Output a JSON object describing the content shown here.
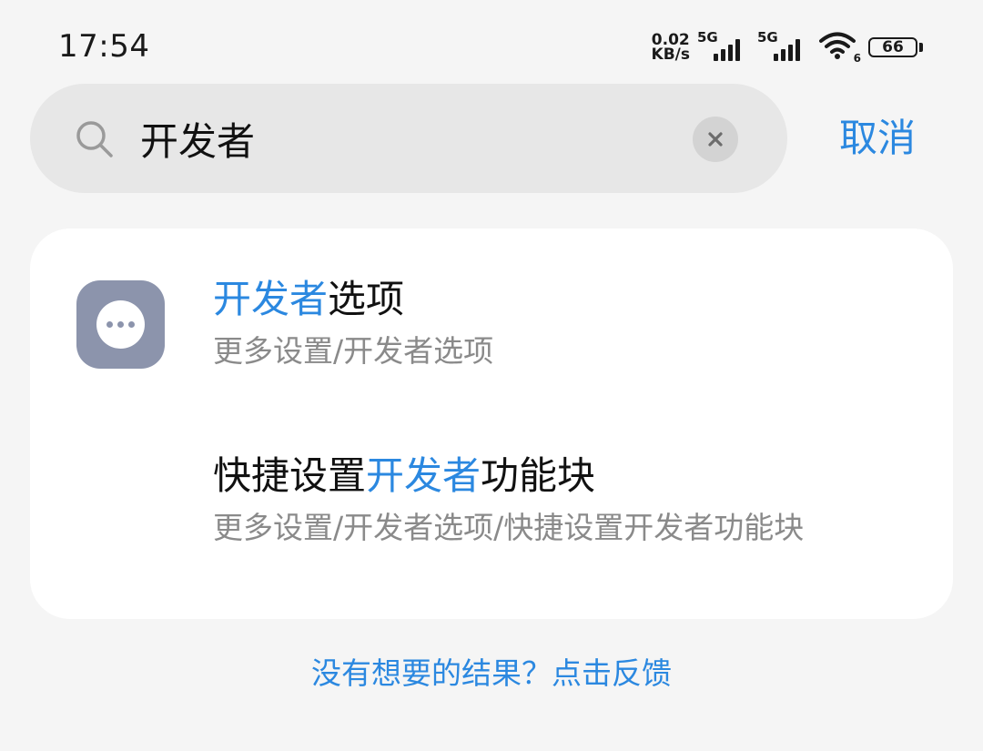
{
  "status_bar": {
    "time": "17:54",
    "net_speed_value": "0.02",
    "net_speed_unit": "KB/s",
    "sim1_network": "5G",
    "sim2_network": "5G",
    "wifi_standard": "6",
    "battery_level": "66"
  },
  "search": {
    "query": "开发者",
    "cancel_label": "取消"
  },
  "results": [
    {
      "title_highlight": "开发者",
      "title_suffix": "选项",
      "path": "更多设置/开发者选项",
      "icon": "more-dots-icon"
    },
    {
      "title_prefix": "快捷设置",
      "title_highlight": "开发者",
      "title_suffix": "功能块",
      "path": "更多设置/开发者选项/快捷设置开发者功能块"
    }
  ],
  "feedback_label": "没有想要的结果？点击反馈",
  "colors": {
    "accent": "#2b88e0",
    "background": "#f5f5f5",
    "card": "#ffffff",
    "search_field": "#e7e7e7",
    "app_icon": "#8c94ac",
    "secondary_text": "#8a8a8a"
  }
}
